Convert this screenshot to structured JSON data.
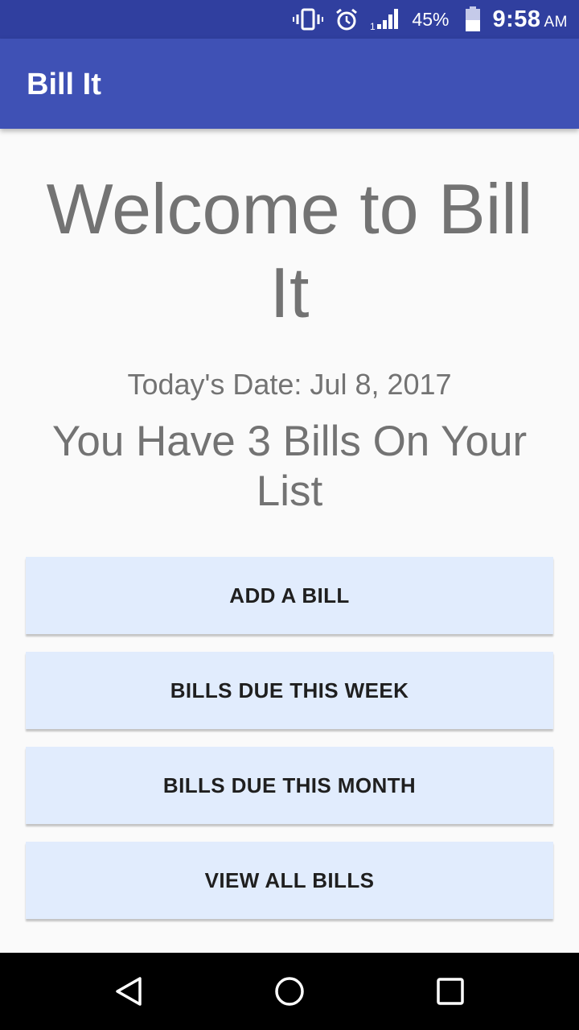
{
  "status_bar": {
    "battery_percent": "45%",
    "time": "9:58",
    "ampm": "AM",
    "icons": [
      "vibrate-icon",
      "alarm-icon",
      "signal-icon",
      "battery-icon"
    ]
  },
  "app_bar": {
    "title": "Bill It"
  },
  "main": {
    "welcome": "Welcome to Bill It",
    "date_text": "Today's Date: Jul 8, 2017",
    "bill_count_text": "You Have 3 Bills On Your List"
  },
  "buttons": {
    "add_bill": "ADD A BILL",
    "due_week": "BILLS DUE THIS WEEK",
    "due_month": "BILLS DUE THIS MONTH",
    "view_all": "VIEW ALL BILLS"
  },
  "nav_bar": {
    "icons": [
      "back-icon",
      "home-icon",
      "recents-icon"
    ]
  },
  "colors": {
    "status_bar": "#303f9f",
    "app_bar": "#3f51b5",
    "background": "#fafafa",
    "button_bg": "#e1ecfd",
    "text_gray": "#737373"
  }
}
